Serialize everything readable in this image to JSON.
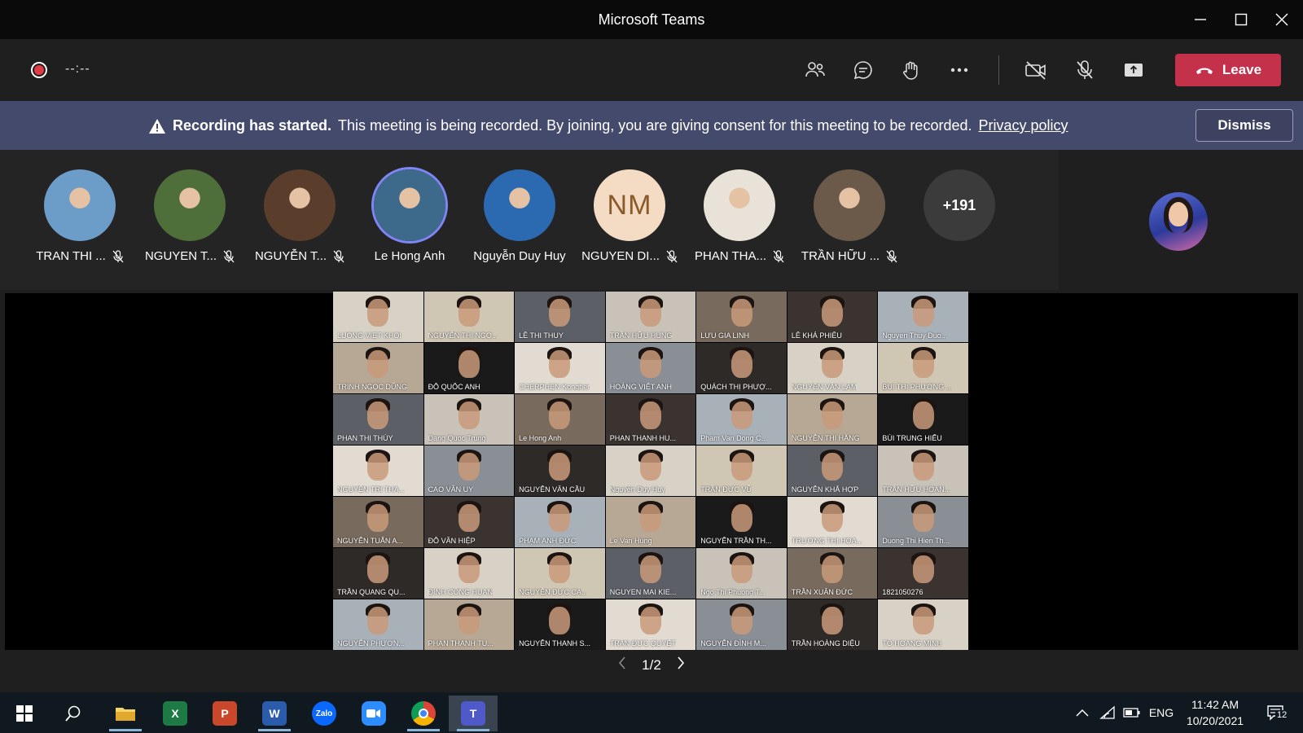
{
  "window": {
    "title": "Microsoft Teams"
  },
  "toolbar": {
    "timer": "--:--",
    "leave_label": "Leave",
    "buttons": [
      "people-icon",
      "chat-icon",
      "raise-hand-icon",
      "more-icon",
      "camera-off-icon",
      "mic-off-icon",
      "share-icon"
    ]
  },
  "banner": {
    "heading": "Recording has started.",
    "message": "This meeting is being recorded. By joining, you are giving consent for this meeting to be recorded.",
    "link": "Privacy policy",
    "dismiss_label": "Dismiss"
  },
  "participants": [
    {
      "name": "TRAN THI ...",
      "muted": true,
      "color": "#6c9cc8"
    },
    {
      "name": "NGUYEN T...",
      "muted": true,
      "color": "#4e6e3a"
    },
    {
      "name": "NGUYỄN T...",
      "muted": true,
      "color": "#5a3d2b"
    },
    {
      "name": "Le Hong Anh",
      "muted": false,
      "active": true,
      "color": "#3d6a8a"
    },
    {
      "name": "Nguyễn Duy Huy",
      "muted": false,
      "color": "#2b6ab0"
    },
    {
      "name": "NGUYEN DI...",
      "muted": true,
      "initials": "NM"
    },
    {
      "name": "PHAN THA...",
      "muted": true,
      "color": "#e8e2d8"
    },
    {
      "name": "TRẦN HỮU ...",
      "muted": true,
      "color": "#6b5a4a"
    }
  ],
  "overflow_count": "+191",
  "grid": [
    "LUONG VIET KHOI",
    "NGUYỄN THỊ NGỌ...",
    "LÊ THI THUY",
    "TRẦN HỮU HUNG",
    "LƯU GIA LINH",
    "LÊ KHẢ PHIÊU",
    "Nguyen Thuy Duo...",
    "TRINH NGỌC DŨNG",
    "ĐỖ QUỐC ANH",
    "CHERPHEN Kongher",
    "HOÀNG VIỆT ANH",
    "QUÁCH THỊ PHƯỢ...",
    "NGUYỄN VĂN LÂM",
    "BÙI THỊ PHƯƠNG ...",
    "PHAN THỊ THÚY",
    "Dang Quoc Trung",
    "Le Hong Anh",
    "PHAN THANH HU...",
    "Pham Van Dong C...",
    "NGUYỄN THỊ HẰNG",
    "BÙI TRUNG HIẾU",
    "NGUYỄN TRÍ THA...",
    "CAO VĂN UY",
    "NGUYỄN VĂN CẦU",
    "Nguyễn Duy Huy",
    "TRẦN ĐỨC VŨ",
    "NGUYỄN KHẮ HỢP",
    "TRẦN HỮU HOÀN...",
    "NGUYỄN TUẤN A...",
    "ĐỖ VĂN HIỆP",
    "PHẠM ANH ĐỨC",
    "Le Van Hung",
    "NGUYỄN TRẦN TH...",
    "TRƯƠNG THỊ HOA...",
    "Duong Thi Hien Th...",
    "TRẦN QUANG QU...",
    "ĐINH CÔNG HUAN",
    "NGUYỄN ĐỨC CÁ...",
    "NGUYEN MAI KIE...",
    "Ngo Thi Phuong T...",
    "TRẦN XUÂN ĐỨC",
    "1821050276",
    "NGUYỄN PHƯƠN...",
    "PHAN THANH TU...",
    "NGUYỄN THANH S...",
    "TRẦN ĐỨC QUYẾT",
    "NGUYỄN ĐÌNH M...",
    "TRẦN HOÀNG DIỆU",
    "TÔ HOÀNG MINH"
  ],
  "pager": {
    "label": "1/2"
  },
  "taskbar": {
    "apps": [
      {
        "name": "file-explorer-icon",
        "color": "#f2c14e",
        "text": "",
        "running": true
      },
      {
        "name": "excel-icon",
        "color": "#1d7a45",
        "text": "X",
        "running": false
      },
      {
        "name": "powerpoint-icon",
        "color": "#c9472b",
        "text": "P",
        "running": false
      },
      {
        "name": "word-icon",
        "color": "#2b5cab",
        "text": "W",
        "running": true
      },
      {
        "name": "zalo-icon",
        "color": "#0a68ff",
        "text": "Zalo",
        "running": false
      },
      {
        "name": "zoom-icon",
        "color": "#2d8cff",
        "text": "",
        "running": false
      },
      {
        "name": "chrome-icon",
        "color": "#db4437",
        "text": "",
        "running": true
      },
      {
        "name": "teams-icon",
        "color": "#5059c9",
        "text": "T",
        "running": true,
        "active": true
      }
    ],
    "lang": "ENG",
    "time": "11:42 AM",
    "date": "10/20/2021",
    "notifications": "12"
  }
}
